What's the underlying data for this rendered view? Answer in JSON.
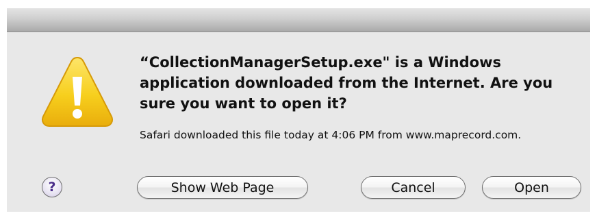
{
  "dialog": {
    "headline": "“CollectionManagerSetup.exe\" is a Windows application downloaded from the Internet. Are you sure you want to open it?",
    "subtext": "Safari downloaded this file today at 4:06 PM from www.maprecord.com.",
    "icon": "warning-icon",
    "help_label": "?",
    "help_icon": "help-icon"
  },
  "buttons": {
    "show_web_page": "Show Web Page",
    "cancel": "Cancel",
    "open": "Open"
  },
  "colors": {
    "warning_yellow": "#f6cf1f",
    "dialog_bg": "#e8e8e8"
  }
}
